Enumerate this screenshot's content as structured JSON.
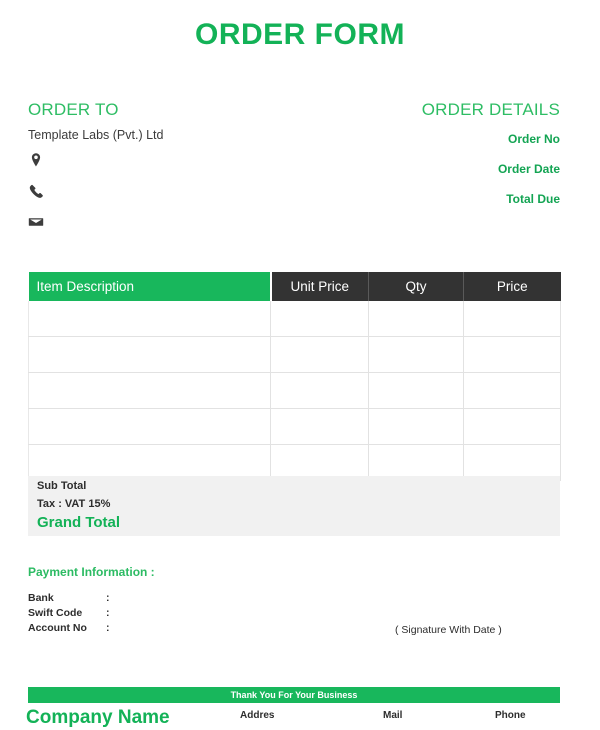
{
  "document": {
    "title": "ORDER FORM",
    "accent_green": "#13b257",
    "header_dark": "#333333",
    "totals_band_bg": "#f1f1f1"
  },
  "order_to": {
    "heading": "ORDER TO",
    "client_name": "Template Labs (Pvt.) Ltd",
    "contacts": [
      {
        "icon": "location-pin-icon",
        "value": ""
      },
      {
        "icon": "phone-icon",
        "value": ""
      },
      {
        "icon": "envelope-icon",
        "value": ""
      }
    ]
  },
  "order_details": {
    "heading": "ORDER DETAILS",
    "rows": [
      {
        "label": "Order No",
        "value": ""
      },
      {
        "label": "Order Date",
        "value": ""
      },
      {
        "label": "Total Due",
        "value": ""
      }
    ]
  },
  "items_table": {
    "columns": [
      "Item Description",
      "Unit Price",
      "Qty",
      "Price"
    ],
    "rows": [
      {
        "description": "",
        "unit_price": "",
        "qty": "",
        "price": ""
      },
      {
        "description": "",
        "unit_price": "",
        "qty": "",
        "price": ""
      },
      {
        "description": "",
        "unit_price": "",
        "qty": "",
        "price": ""
      },
      {
        "description": "",
        "unit_price": "",
        "qty": "",
        "price": ""
      },
      {
        "description": "",
        "unit_price": "",
        "qty": "",
        "price": ""
      }
    ]
  },
  "totals": {
    "sub_total_label": "Sub Total",
    "sub_total_value": "",
    "tax_label": "Tax : VAT  15%",
    "tax_value": "",
    "grand_total_label": "Grand Total",
    "grand_total_value": ""
  },
  "payment": {
    "heading": "Payment Information :",
    "lines": [
      {
        "label": "Bank",
        "colon": ":",
        "value": ""
      },
      {
        "label": "Swift Code",
        "colon": ":",
        "value": ""
      },
      {
        "label": "Account No",
        "colon": ":",
        "value": ""
      }
    ],
    "signature_label": "( Signature With Date )"
  },
  "footer": {
    "thanks": "Thank You For Your Business",
    "company_name": "Company Name",
    "columns": [
      {
        "label": "Addres",
        "value": ""
      },
      {
        "label": "Mail",
        "value": ""
      },
      {
        "label": "Phone",
        "value": ""
      }
    ]
  }
}
